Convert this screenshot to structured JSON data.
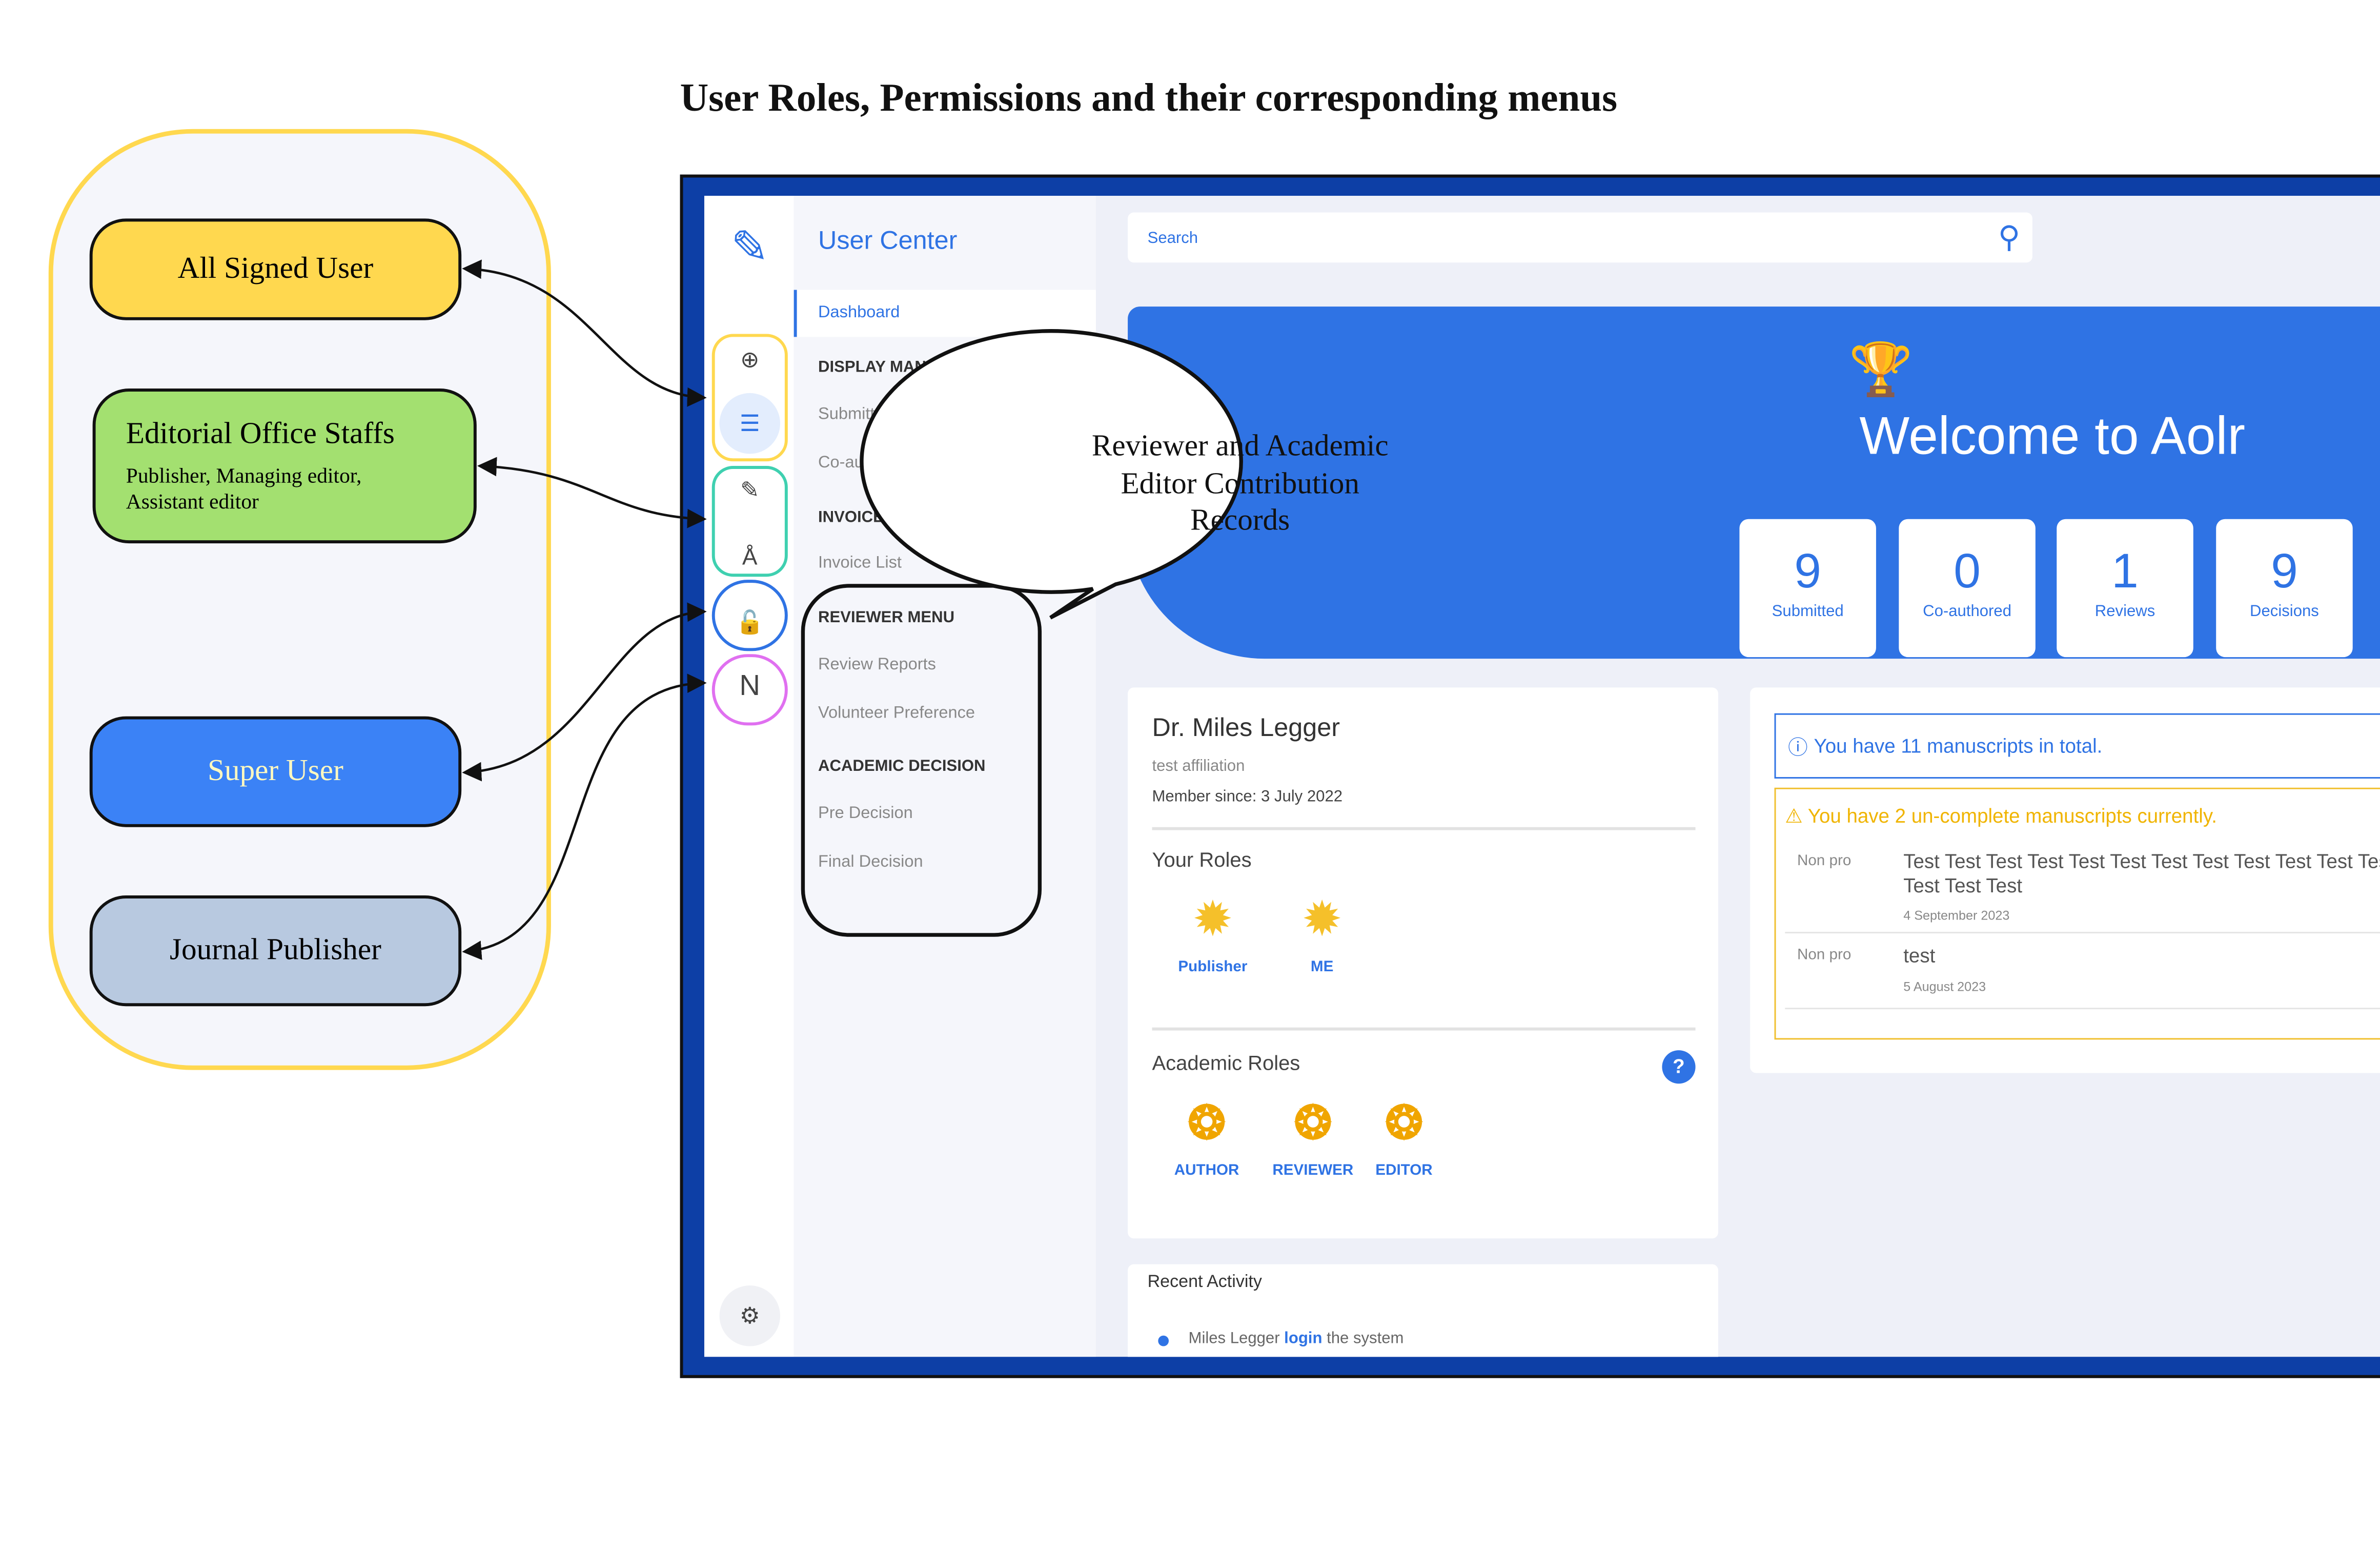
{
  "title": "User Roles, Permissions and their corresponding menus",
  "roles": [
    {
      "label": "All Signed User",
      "color": "#ffd84f"
    },
    {
      "label": "Editorial Office Staffs",
      "sub": "Publisher, Managing editor, Assistant editor",
      "color": "#a3e070"
    },
    {
      "label": "Super User",
      "color": "#3b82f6"
    },
    {
      "label": "Journal Publisher",
      "color": "#b8c9e0"
    }
  ],
  "callout": "Reviewer and Academic Editor Contribution Records",
  "app": {
    "nav_title": "User Center",
    "nav": {
      "dashboard": "Dashboard",
      "h1": "DISPLAY MANUSCRIPTS",
      "i1": "Submitted Manuscripts",
      "i2": "Co-author Manuscripts",
      "h2": "INVOICE MENU",
      "i3": "Invoice List",
      "h3": "REVIEWER MENU",
      "i4": "Review Reports",
      "i5": "Volunteer Preference",
      "h4": "ACADEMIC DECISION",
      "i6": "Pre Decision",
      "i7": "Final Decision"
    },
    "rail_icons": [
      "logo-tools-icon",
      "plus-circle-icon",
      "checklist-icon",
      "edit-icon",
      "compass-icon",
      "unlock-icon",
      "n-letter-icon",
      "gear-icon"
    ],
    "rail_n": "N",
    "search_placeholder": "Search",
    "welcome": "Welcome to Aolr",
    "stats": [
      {
        "n": "9",
        "l": "Submitted"
      },
      {
        "n": "0",
        "l": "Co-authored"
      },
      {
        "n": "1",
        "l": "Reviews"
      },
      {
        "n": "9",
        "l": "Decisions"
      }
    ],
    "profile": {
      "name": "Dr. Miles Legger",
      "affiliation": "test affiliation",
      "member": "Member since: 3 July 2022",
      "your_roles": "Your Roles",
      "roles": [
        "Publisher",
        "ME"
      ],
      "academic_roles": "Academic Roles",
      "academic": [
        "AUTHOR",
        "REVIEWER",
        "EDITOR"
      ],
      "help": "?"
    },
    "activity": {
      "title": "Recent Activity",
      "pre": "Miles Legger ",
      "link": "login",
      "post": " the system"
    },
    "info": "You have 11 manuscripts in total.",
    "warn": "You have 2 un-complete manuscripts currently.",
    "manuscripts": [
      {
        "type": "Non pro",
        "title": "Test Test Test Test Test Test Test Test Test Test Test Test Test Test Test",
        "date": "4 September 2023"
      },
      {
        "type": "Non pro",
        "title": "test",
        "date": "5 August 2023"
      }
    ],
    "colors": {
      "frame": "#0d3fa6",
      "accent": "#2f73e4",
      "warn": "#f0b400"
    }
  }
}
